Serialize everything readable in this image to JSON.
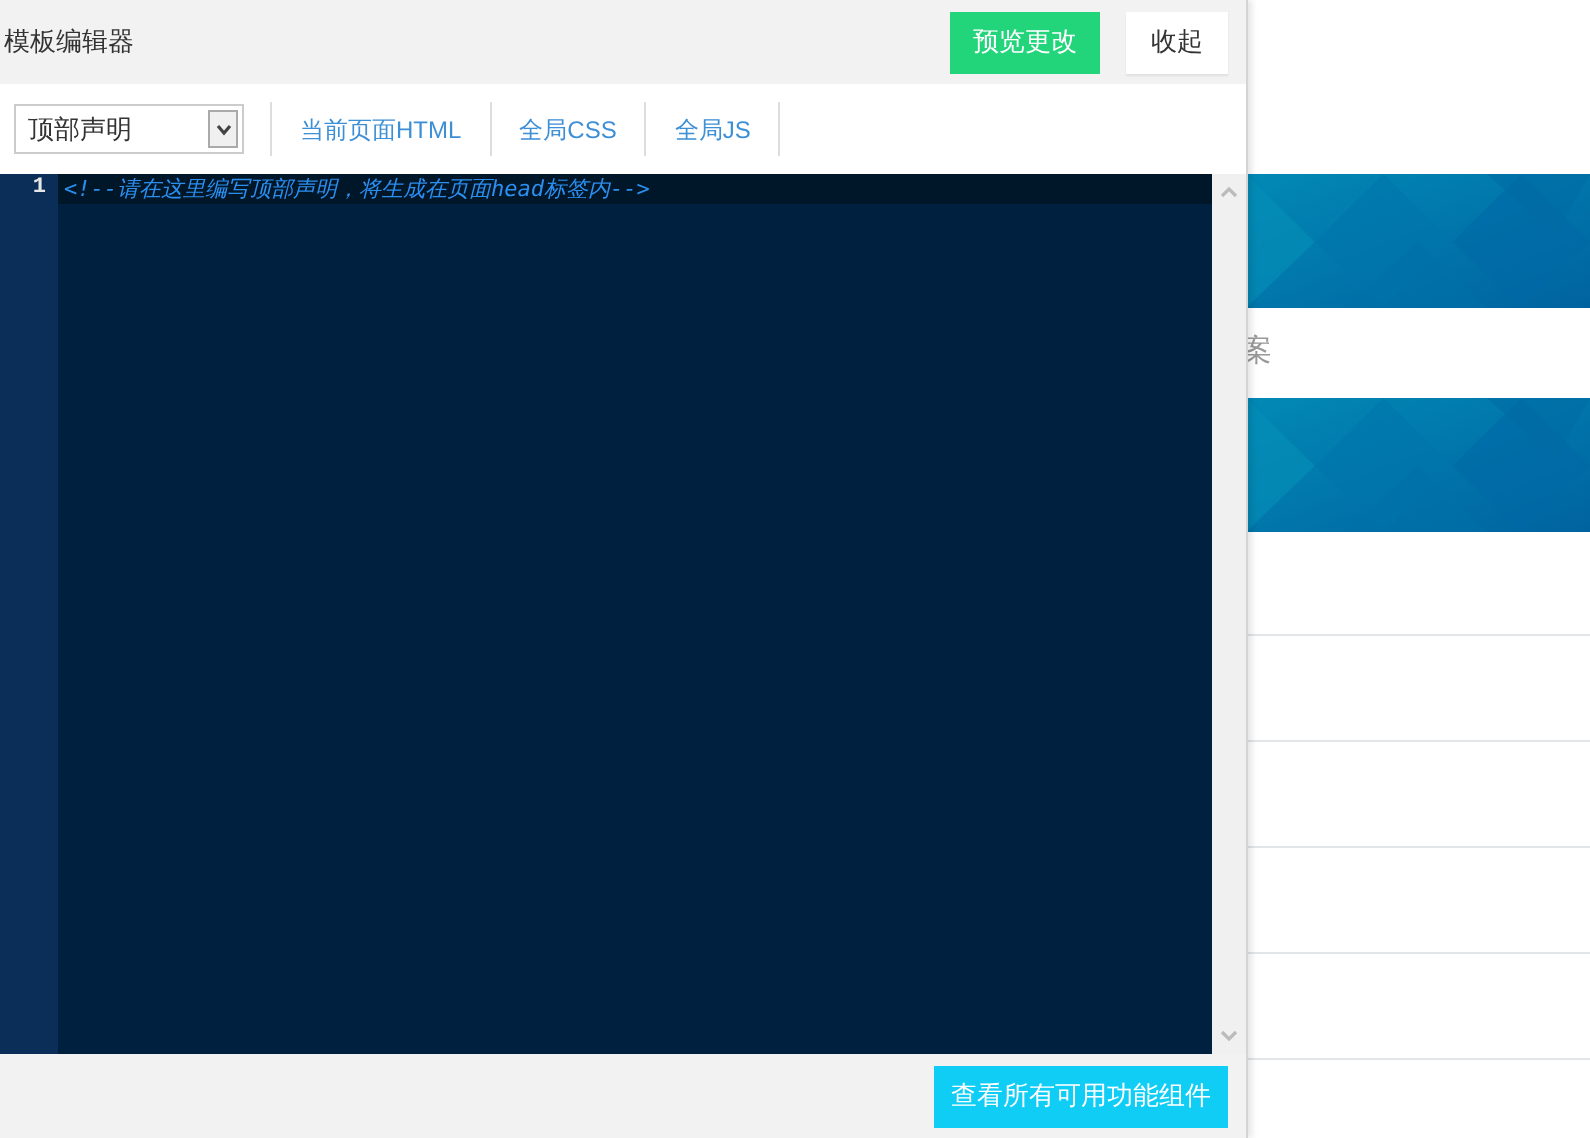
{
  "editor": {
    "title": "模板编辑器",
    "preview_button": "预览更改",
    "collapse_button": "收起",
    "dropdown": {
      "value": "顶部声明"
    },
    "links": [
      "当前页面HTML",
      "全局CSS",
      "全局JS"
    ],
    "code_lines": [
      {
        "number": "1",
        "text": "<!--请在这里编写顶部声明，将生成在页面head标签内-->"
      }
    ],
    "footer_button": "查看所有可用功能组件"
  },
  "background": {
    "blocks": [
      {
        "kind": "picture"
      },
      {
        "kind": "text",
        "text": "案"
      },
      {
        "kind": "picture"
      }
    ]
  }
}
